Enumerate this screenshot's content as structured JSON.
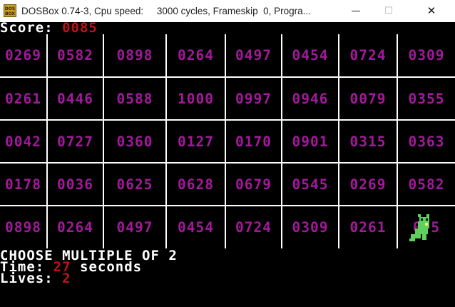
{
  "window": {
    "app_icon_text": "DOS BOX",
    "title": "DOSBox 0.74-3, Cpu speed:     3000 cycles, Frameskip  0, Progra...",
    "minimize_glyph": "—",
    "maximize_glyph": "☐",
    "close_glyph": "✕"
  },
  "score": {
    "label": "Score:",
    "value": "0085"
  },
  "board": {
    "rows": [
      [
        "0269",
        "0582",
        "0898",
        "0264",
        "0497",
        "0454",
        "0724",
        "0309"
      ],
      [
        "0261",
        "0446",
        "0588",
        "1000",
        "0997",
        "0946",
        "0079",
        "0355"
      ],
      [
        "0042",
        "0727",
        "0360",
        "0127",
        "0170",
        "0901",
        "0315",
        "0363"
      ],
      [
        "0178",
        "0036",
        "0625",
        "0628",
        "0679",
        "0545",
        "0269",
        "0582"
      ],
      [
        "0898",
        "0264",
        "0497",
        "0454",
        "0724",
        "0309",
        "0261",
        "0 5"
      ]
    ],
    "player_cell": {
      "row": 4,
      "col": 7
    }
  },
  "status": {
    "instruction": "CHOOSE MULTIPLE OF 2",
    "time_label": "Time:",
    "time_value": "27",
    "time_unit": "seconds",
    "lives_label": "Lives:",
    "lives_value": "2"
  },
  "colors": {
    "number": "#a4189c",
    "highlight": "#c0101a",
    "text": "#ffffff",
    "grid": "#ffffff",
    "muncher": "#5fd05f"
  }
}
